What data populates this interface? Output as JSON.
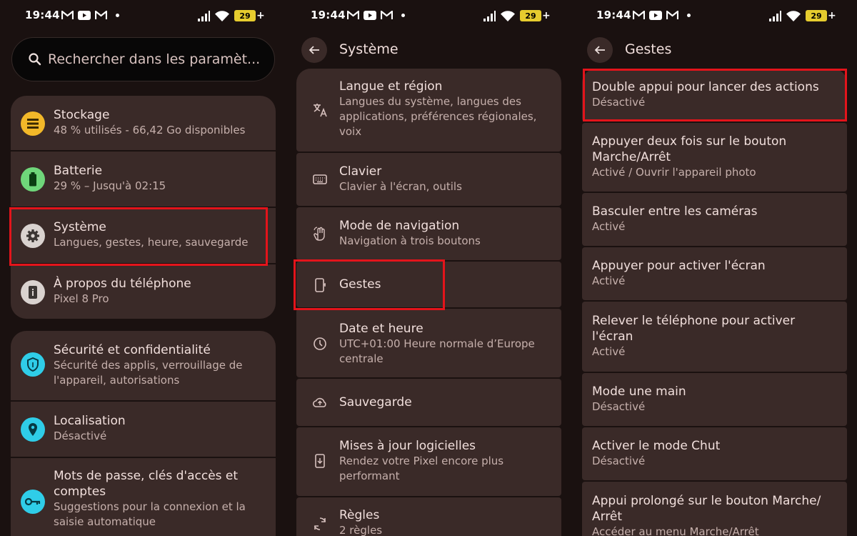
{
  "status": {
    "time": "19:44",
    "battery": "29"
  },
  "screen1": {
    "search_placeholder": "Rechercher dans les paramèt...",
    "group1": [
      {
        "title": "Stockage",
        "sub": "48 % utilisés - 66,42 Go disponibles",
        "icon": "storage-icon",
        "color": "#f2b829"
      },
      {
        "title": "Batterie",
        "sub": "29 % – Jusqu'à 02:15",
        "icon": "battery-icon",
        "color": "#6fd67a"
      },
      {
        "title": "Système",
        "sub": "Langues, gestes, heure, sauvegarde",
        "icon": "gear-icon",
        "color": "#d9d2cf"
      },
      {
        "title": "À propos du téléphone",
        "sub": "Pixel 8 Pro",
        "icon": "info-icon",
        "color": "#d9d2cf"
      }
    ],
    "group2": [
      {
        "title": "Sécurité et confidentialité",
        "sub": "Sécurité des applis, verrouillage de l'appareil, autorisations",
        "icon": "shield-icon",
        "color": "#2fcde8"
      },
      {
        "title": "Localisation",
        "sub": "Désactivé",
        "icon": "location-icon",
        "color": "#2fcde8"
      },
      {
        "title": "Mots de passe, clés d'accès et comptes",
        "sub": "Suggestions pour la connexion et la saisie automatique",
        "icon": "key-icon",
        "color": "#2fcde8"
      }
    ]
  },
  "screen2": {
    "title": "Système",
    "items": [
      {
        "title": "Langue et région",
        "sub": "Langues du système, langues des applications, préférences régionales, voix",
        "icon": "translate-icon"
      },
      {
        "title": "Clavier",
        "sub": "Clavier à l'écran, outils",
        "icon": "keyboard-icon"
      },
      {
        "title": "Mode de navigation",
        "sub": "Navigation à trois boutons",
        "icon": "gesture-hand-icon"
      },
      {
        "title": "Gestes",
        "sub": "",
        "icon": "phone-gesture-icon"
      },
      {
        "title": "Date et heure",
        "sub": "UTC+01:00 Heure normale d’Europe centrale",
        "icon": "clock-icon"
      },
      {
        "title": "Sauvegarde",
        "sub": "",
        "icon": "cloud-upload-icon"
      },
      {
        "title": "Mises à jour logicielles",
        "sub": "Rendez votre Pixel encore plus performant",
        "icon": "system-update-icon"
      },
      {
        "title": "Règles",
        "sub": "2 règles",
        "icon": "rules-icon"
      }
    ]
  },
  "screen3": {
    "title": "Gestes",
    "items": [
      {
        "title": "Double appui pour lancer des actions",
        "sub": "Désactivé"
      },
      {
        "title": "Appuyer deux fois sur le bouton Marche/Arrêt",
        "sub": "Activé / Ouvrir l'appareil photo"
      },
      {
        "title": "Basculer entre les caméras",
        "sub": "Activé"
      },
      {
        "title": "Appuyer pour activer l'écran",
        "sub": "Activé"
      },
      {
        "title": "Relever le téléphone pour activer l'écran",
        "sub": "Activé"
      },
      {
        "title": "Mode une main",
        "sub": "Désactivé"
      },
      {
        "title": "Activer le mode Chut",
        "sub": "Désactivé"
      },
      {
        "title": "Appui prolongé sur le bouton Marche/ Arrêt",
        "sub": "Accéder au menu Marche/Arrêt"
      }
    ]
  },
  "colors": {
    "highlight": "#e3141b",
    "card": "#3a2a28",
    "background": "#1a1110"
  }
}
